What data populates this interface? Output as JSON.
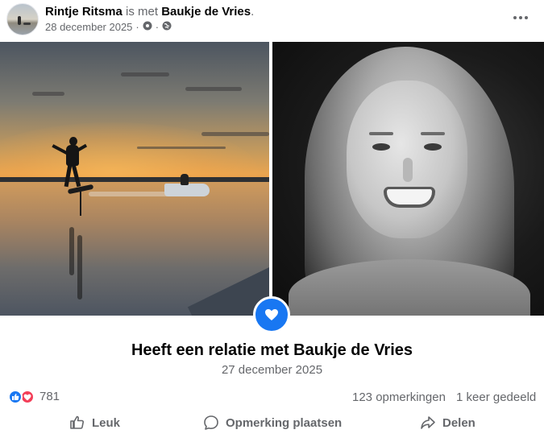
{
  "post": {
    "author": "Rintje Ritsma",
    "connector": "is met",
    "tagged": "Baukje de Vries",
    "period": ".",
    "date": "28 december 2025",
    "separator": "·"
  },
  "icons": {
    "more": "more-horizontal-icon",
    "privacy": "globe-icon",
    "settings": "gear-icon",
    "badge": "heart-icon",
    "like": "thumbs-up-icon",
    "comment": "comment-bubble-icon",
    "share": "share-arrow-icon"
  },
  "life_event": {
    "title": "Heeft een relatie met Baukje de Vries",
    "date": "27 december 2025"
  },
  "stats": {
    "reaction_count": "781",
    "comments": "123 opmerkingen",
    "shares": "1 keer gedeeld"
  },
  "actions": {
    "like": "Leuk",
    "comment": "Opmerking plaatsen",
    "share": "Delen"
  },
  "colors": {
    "accent": "#1877f2",
    "love": "#f33e58",
    "secondary_text": "#65676b"
  }
}
